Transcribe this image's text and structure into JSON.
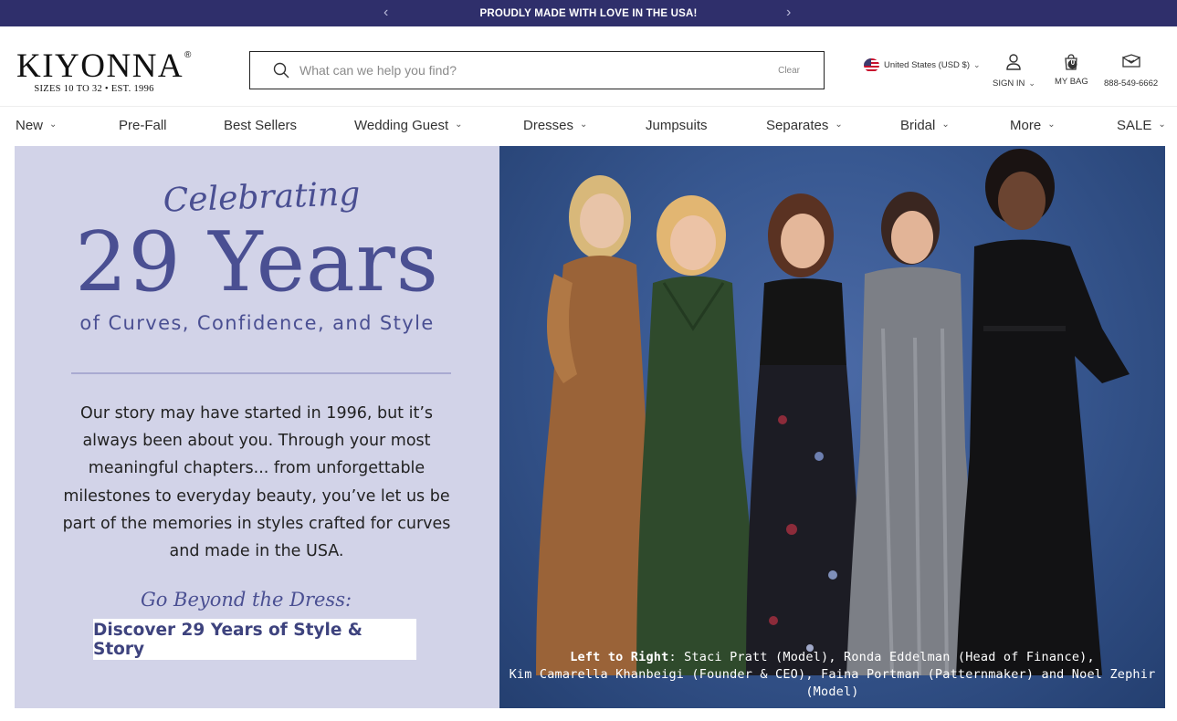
{
  "announcement": {
    "message": "PROUDLY MADE WITH LOVE IN THE USA!",
    "prev_icon": "‹",
    "next_icon": "›"
  },
  "header": {
    "logo": {
      "name": "KIYONNA",
      "reg": "®",
      "tagline": "SIZES 10 TO 32  •  EST. 1996"
    },
    "search": {
      "placeholder": "What can we help you find?",
      "value": "",
      "clear_label": "Clear"
    },
    "country": {
      "label": "United States (USD $)"
    },
    "sign_in": {
      "label": "SIGN IN"
    },
    "bag": {
      "label": "MY BAG",
      "count": "0"
    },
    "phone": {
      "label": "888-549-6662"
    }
  },
  "nav": {
    "items": [
      {
        "label": "New",
        "dropdown": true
      },
      {
        "label": "Pre-Fall",
        "dropdown": false
      },
      {
        "label": "Best Sellers",
        "dropdown": false
      },
      {
        "label": "Wedding Guest",
        "dropdown": true
      },
      {
        "label": "Dresses",
        "dropdown": true
      },
      {
        "label": "Jumpsuits",
        "dropdown": false
      },
      {
        "label": "Separates",
        "dropdown": true
      },
      {
        "label": "Bridal",
        "dropdown": true
      },
      {
        "label": "More",
        "dropdown": true
      },
      {
        "label": "SALE",
        "dropdown": true
      }
    ]
  },
  "hero": {
    "kicker": "Celebrating",
    "headline": "29 Years",
    "subtitle": "of Curves, Confidence, and Style",
    "story": "Our story may have started in 1996, but it’s always been about you. Through your most meaningful chapters... from unforgettable milestones to everyday beauty, you’ve let us be part of the memories in styles crafted for curves and made in the USA.",
    "beyond": "Go Beyond the Dress:",
    "cta": "Discover 29 Years of Style & Story",
    "caption_lead": "Left to Right",
    "caption_line1": ": Staci Pratt (Model), Ronda Eddelman (Head of Finance),",
    "caption_line2": "Kim Camarella Khanbeigi (Founder & CEO), Faina Portman (Patternmaker) and Noel Zephir (Model)"
  },
  "colors": {
    "announcement_bg": "#2f2f6b",
    "brand_accent": "#4a4f92",
    "hero_panel_bg": "#d2d3e8",
    "photo_bg": "#385891"
  }
}
